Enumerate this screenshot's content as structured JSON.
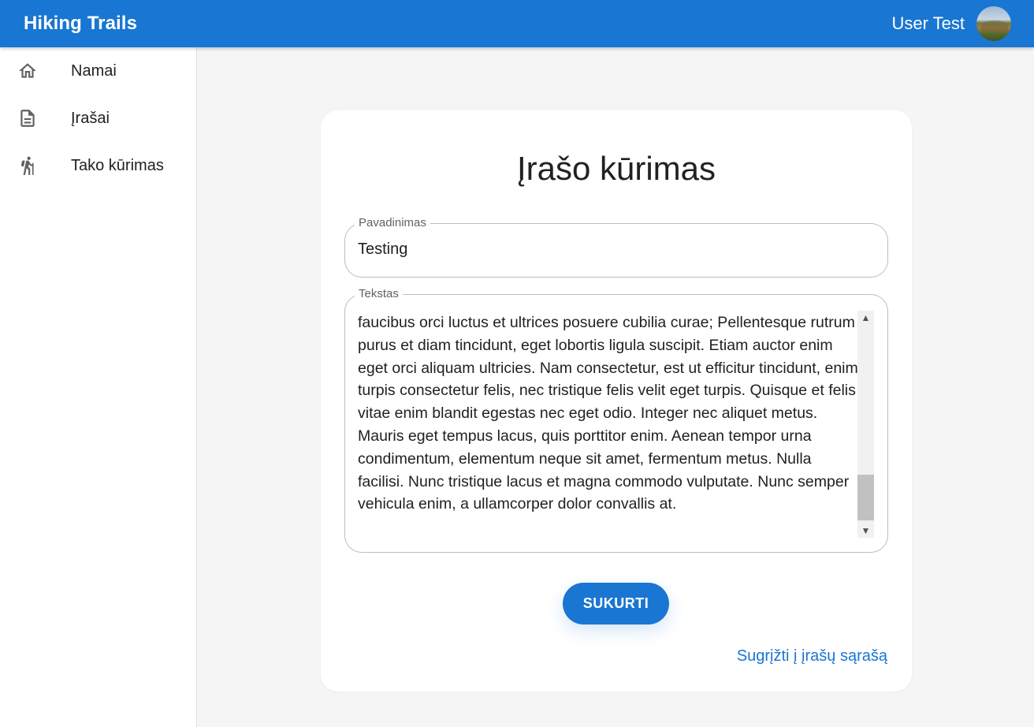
{
  "app": {
    "title": "Hiking Trails"
  },
  "user": {
    "name": "User Test"
  },
  "sidebar": {
    "items": [
      {
        "label": "Namai",
        "icon": "home-icon"
      },
      {
        "label": "Įrašai",
        "icon": "document-icon"
      },
      {
        "label": "Tako kūrimas",
        "icon": "hiker-icon"
      }
    ]
  },
  "form": {
    "title": "Įrašo kūrimas",
    "name_label": "Pavadinimas",
    "name_value": "Testing",
    "text_label": "Tekstas",
    "text_value": "faucibus orci luctus et ultrices posuere cubilia curae; Pellentesque rutrum purus et diam tincidunt, eget lobortis ligula suscipit. Etiam auctor enim eget orci aliquam ultricies. Nam consectetur, est ut efficitur tincidunt, enim turpis consectetur felis, nec tristique felis velit eget turpis. Quisque et felis vitae enim blandit egestas nec eget odio. Integer nec aliquet metus. Mauris eget tempus lacus, quis porttitor enim. Aenean tempor urna condimentum, elementum neque sit amet, fermentum metus. Nulla facilisi. Nunc tristique lacus et magna commodo vulputate. Nunc semper vehicula enim, a ullamcorper dolor convallis at.",
    "submit_label": "SUKURTI",
    "back_link": "Sugrįžti į įrašų sąrašą"
  },
  "colors": {
    "primary": "#1976d2",
    "background": "#f5f5f5",
    "surface": "#ffffff"
  }
}
